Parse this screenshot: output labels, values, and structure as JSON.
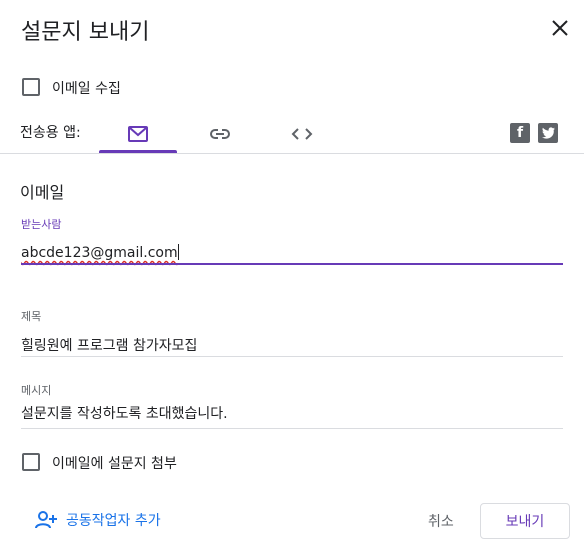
{
  "dialog": {
    "title": "설문지 보내기"
  },
  "collect_email": {
    "label": "이메일 수집",
    "checked": false
  },
  "send_via": {
    "label": "전송용 앱:",
    "tabs": [
      {
        "icon": "mail-icon",
        "active": true
      },
      {
        "icon": "link-icon",
        "active": false
      },
      {
        "icon": "embed-code-icon",
        "active": false
      }
    ],
    "social": [
      {
        "icon": "facebook-icon"
      },
      {
        "icon": "twitter-icon"
      }
    ]
  },
  "email_section": {
    "heading": "이메일",
    "to": {
      "label": "받는사람",
      "value": "abcde123@gmail.com"
    },
    "subject": {
      "label": "제목",
      "value": "힐링원예 프로그램 참가자모집"
    },
    "message": {
      "label": "메시지",
      "value": "설문지를 작성하도록 초대했습니다."
    },
    "attach_form": {
      "label": "이메일에 설문지 첨부",
      "checked": false
    }
  },
  "footer": {
    "add_collaborators": "공동작업자 추가",
    "cancel": "취소",
    "send": "보내기"
  },
  "colors": {
    "accent": "#673ab7",
    "link": "#1a73e8",
    "spellcheck": "#d93025"
  }
}
